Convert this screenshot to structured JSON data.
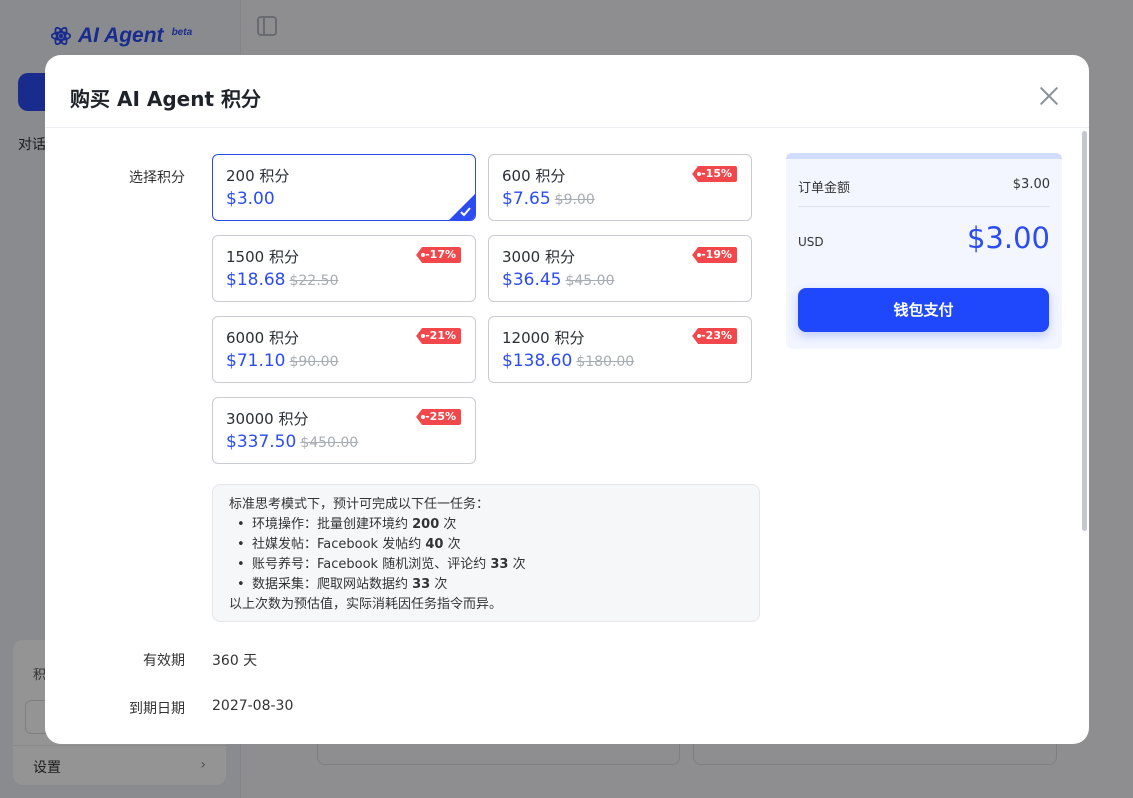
{
  "background": {
    "logo_text": "AI Agent",
    "logo_sup": "beta",
    "sidebar_label": "对话",
    "card_label": "积",
    "settings_label": "设置"
  },
  "modal": {
    "title": "购买 AI Agent 积分",
    "select_label": "选择积分",
    "plans": [
      {
        "name": "200 积分",
        "price": "$3.00",
        "original": "",
        "discount": "",
        "selected": true
      },
      {
        "name": "600 积分",
        "price": "$7.65",
        "original": "$9.00",
        "discount": "-15%"
      },
      {
        "name": "1500 积分",
        "price": "$18.68",
        "original": "$22.50",
        "discount": "-17%"
      },
      {
        "name": "3000 积分",
        "price": "$36.45",
        "original": "$45.00",
        "discount": "-19%"
      },
      {
        "name": "6000 积分",
        "price": "$71.10",
        "original": "$90.00",
        "discount": "-21%"
      },
      {
        "name": "12000 积分",
        "price": "$138.60",
        "original": "$180.00",
        "discount": "-23%"
      },
      {
        "name": "30000 积分",
        "price": "$337.50",
        "original": "$450.00",
        "discount": "-25%"
      }
    ],
    "info": {
      "heading": "标准思考模式下，预计可完成以下任一任务：",
      "items": [
        {
          "prefix": "环境操作：批量创建环境约 ",
          "count": "200",
          "suffix": " 次"
        },
        {
          "prefix": "社媒发帖：Facebook 发帖约 ",
          "count": "40",
          "suffix": " 次"
        },
        {
          "prefix": "账号养号：Facebook 随机浏览、评论约 ",
          "count": "33",
          "suffix": " 次"
        },
        {
          "prefix": "数据采集：爬取网站数据约 ",
          "count": "33",
          "suffix": " 次"
        }
      ],
      "footer": "以上次数为预估值，实际消耗因任务指令而异。"
    },
    "validity_label": "有效期",
    "validity_value": "360 天",
    "expiry_label": "到期日期",
    "expiry_value": "2027-08-30",
    "summary": {
      "order_label": "订单金额",
      "order_value": "$3.00",
      "currency": "USD",
      "total": "$3.00",
      "pay_button": "钱包支付"
    }
  },
  "colors": {
    "accent": "#2b4cf3",
    "badge": "#f2474b",
    "summary_bg": "#f3f6ff"
  }
}
